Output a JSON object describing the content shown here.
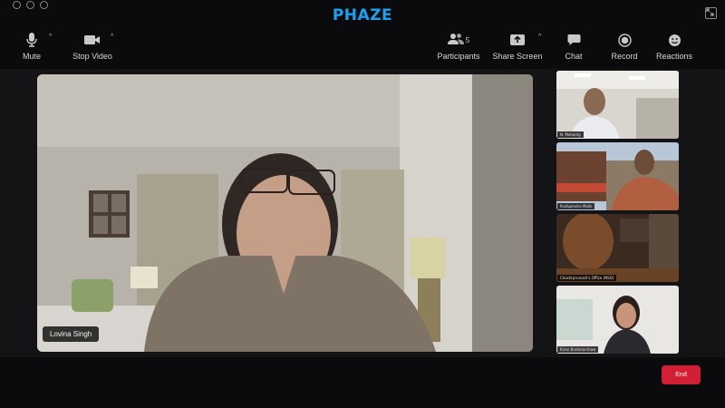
{
  "app": {
    "brand": "PHAZE"
  },
  "toolbar": {
    "mute_label": "Mute",
    "stop_video_label": "Stop Video",
    "participants_label": "Participants",
    "participants_count": "5",
    "share_screen_label": "Share Screen",
    "chat_label": "Chat",
    "record_label": "Record",
    "reactions_label": "Reactions",
    "caret": "^"
  },
  "main_video": {
    "speaker_name": "Lovina Singh"
  },
  "participants": [
    {
      "name": "N. Mohanty"
    },
    {
      "name": "Pushpendra Malik"
    },
    {
      "name": "Chockrprunosh's Office (NSO)"
    },
    {
      "name": "Kiran Brahmarshaw"
    }
  ],
  "controls": {
    "end_label": "End"
  },
  "colors": {
    "brand": "#1aa3f3",
    "end_button": "#d21f36",
    "background": "#0b0b0d"
  }
}
